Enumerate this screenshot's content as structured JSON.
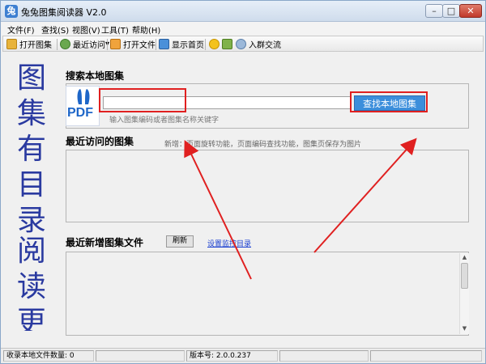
{
  "window": {
    "app_icon": "兔",
    "title": "兔兔图集阅读器 V2.0",
    "min_glyph": "–",
    "max_glyph": "□",
    "close_glyph": "✕"
  },
  "menu": [
    "文件(F)",
    "查找(S)",
    "视图(V)",
    "工具(T)",
    "帮助(H)"
  ],
  "toolbar": {
    "open": "打开图集",
    "recent": "最近访问",
    "recent_caret": "▾",
    "open_file": "打开文件",
    "home": "显示首页",
    "group": "入群交流"
  },
  "side_text": {
    "top": "图集有目录",
    "bottom": "阅读更快"
  },
  "search": {
    "title": "搜索本地图集",
    "logo_text": "PDF",
    "input_value": "",
    "button": "查找本地图集",
    "hint": "输入图集编码或者图集名称关键字"
  },
  "recent": {
    "title": "最近访问的图集",
    "notice": "新增：页面旋转功能，页面编码查找功能，图集页保存为图片"
  },
  "new_files": {
    "title": "最近新增图集文件",
    "refresh": "刷新",
    "link": "设置监控目录"
  },
  "status": {
    "count": "收录本地文件数量: 0",
    "empty1": "",
    "empty2": "",
    "version": "版本号: 2.0.0.237",
    "empty3": ""
  },
  "colors": {
    "accent": "#3c8edb",
    "annotation": "#e02020",
    "side_text": "#2a3aa0",
    "link": "#1a3fd0"
  },
  "icons": {
    "open": "folder-open-icon",
    "recent": "clock-icon",
    "open_file": "file-icon",
    "home": "home-icon",
    "group": "people-icon"
  }
}
